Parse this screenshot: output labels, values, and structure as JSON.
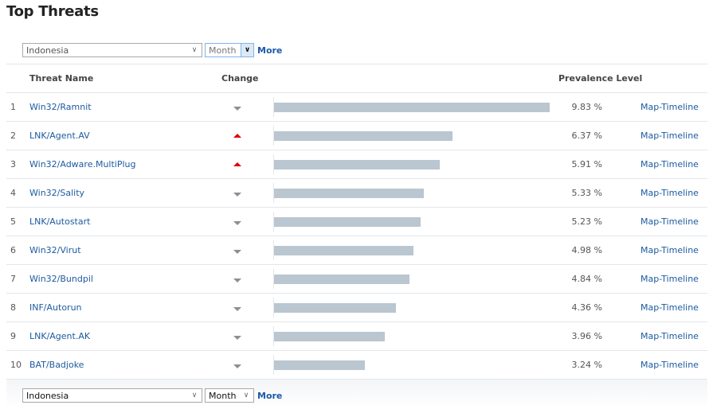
{
  "page": {
    "title": "Top Threats"
  },
  "filters": {
    "country": "Indonesia",
    "period": "Month",
    "more_label": "More"
  },
  "table": {
    "columns": {
      "threat_name": "Threat Name",
      "change": "Change",
      "prevalence": "Prevalence Level"
    },
    "bar_scale_max_percent": 9.83,
    "link_label": "Map-Timeline",
    "rows": [
      {
        "rank": "1",
        "name": "Win32/Ramnit",
        "change": "down",
        "change_icon": "triangle-down-gray",
        "percent": 9.83,
        "percent_label": "9.83 %"
      },
      {
        "rank": "2",
        "name": "LNK/Agent.AV",
        "change": "up",
        "change_icon": "triangle-up-red",
        "percent": 6.37,
        "percent_label": "6.37 %"
      },
      {
        "rank": "3",
        "name": "Win32/Adware.MultiPlug",
        "change": "up",
        "change_icon": "triangle-up-red",
        "percent": 5.91,
        "percent_label": "5.91 %"
      },
      {
        "rank": "4",
        "name": "Win32/Sality",
        "change": "down",
        "change_icon": "triangle-down-gray",
        "percent": 5.33,
        "percent_label": "5.33 %"
      },
      {
        "rank": "5",
        "name": "LNK/Autostart",
        "change": "down",
        "change_icon": "triangle-down-gray",
        "percent": 5.23,
        "percent_label": "5.23 %"
      },
      {
        "rank": "6",
        "name": "Win32/Virut",
        "change": "down",
        "change_icon": "triangle-down-gray",
        "percent": 4.98,
        "percent_label": "4.98 %"
      },
      {
        "rank": "7",
        "name": "Win32/Bundpil",
        "change": "down",
        "change_icon": "triangle-down-gray",
        "percent": 4.84,
        "percent_label": "4.84 %"
      },
      {
        "rank": "8",
        "name": "INF/Autorun",
        "change": "down",
        "change_icon": "triangle-down-gray",
        "percent": 4.36,
        "percent_label": "4.36 %"
      },
      {
        "rank": "9",
        "name": "LNK/Agent.AK",
        "change": "down",
        "change_icon": "triangle-down-gray",
        "percent": 3.96,
        "percent_label": "3.96 %"
      },
      {
        "rank": "10",
        "name": "BAT/Badjoke",
        "change": "down",
        "change_icon": "triangle-down-gray",
        "percent": 3.24,
        "percent_label": "3.24 %"
      }
    ]
  },
  "colors": {
    "link": "#1d5a9f",
    "bar": "#bac6d0",
    "change_up": "#dd0000",
    "change_down": "#8a8f96"
  }
}
